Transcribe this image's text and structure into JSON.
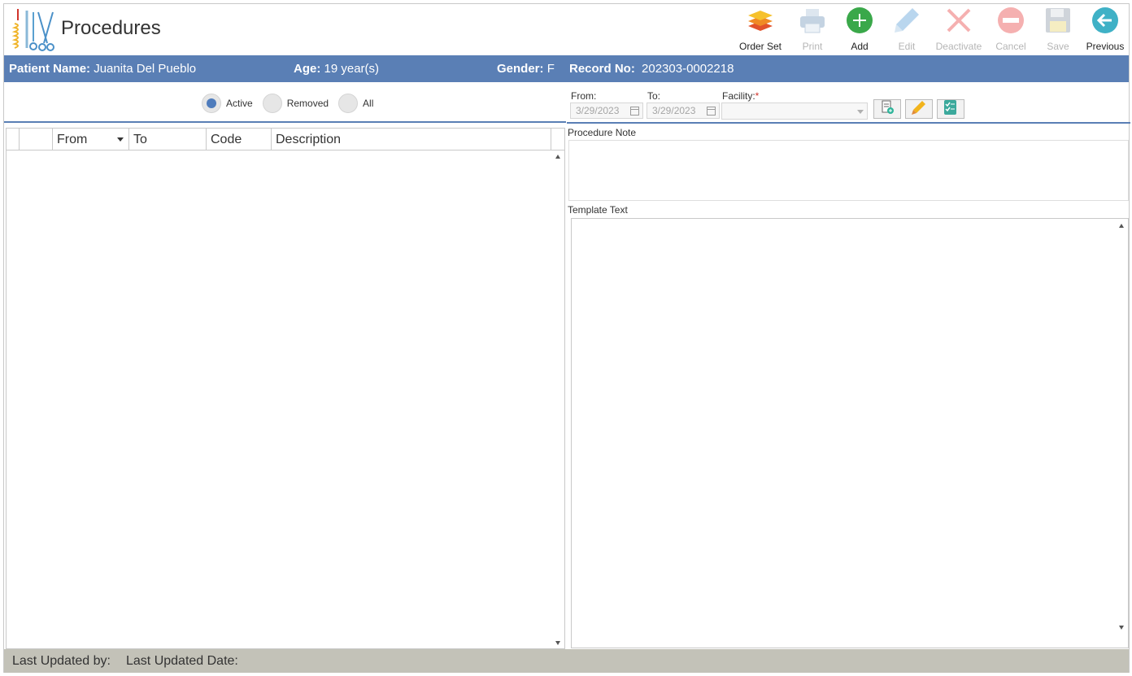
{
  "header": {
    "title": "Procedures",
    "logo_icon": "surgical-instruments-icon"
  },
  "toolbar": [
    {
      "key": "order-set",
      "label": "Order Set",
      "icon": "layers-icon",
      "enabled": true
    },
    {
      "key": "print",
      "label": "Print",
      "icon": "printer-icon",
      "enabled": false
    },
    {
      "key": "add",
      "label": "Add",
      "icon": "plus-circle-icon",
      "enabled": true
    },
    {
      "key": "edit",
      "label": "Edit",
      "icon": "pencil-icon",
      "enabled": false
    },
    {
      "key": "deactivate",
      "label": "Deactivate",
      "icon": "x-icon",
      "enabled": false
    },
    {
      "key": "cancel",
      "label": "Cancel",
      "icon": "minus-circle-icon",
      "enabled": false
    },
    {
      "key": "save",
      "label": "Save",
      "icon": "floppy-disk-icon",
      "enabled": false
    },
    {
      "key": "previous",
      "label": "Previous",
      "icon": "arrow-left-circle-icon",
      "enabled": true
    }
  ],
  "patient": {
    "name_label": "Patient Name:",
    "name": "Juanita Del Pueblo",
    "age_label": "Age:",
    "age": "19 year(s)",
    "gender_label": "Gender:",
    "gender": "F",
    "record_label": "Record No:",
    "record": "202303-0002218"
  },
  "filter": {
    "options": [
      "Active",
      "Removed",
      "All"
    ],
    "selected": "Active"
  },
  "grid": {
    "columns": [
      "",
      "",
      "From",
      "To",
      "Code",
      "Description"
    ],
    "rows": []
  },
  "form": {
    "from_label": "From:",
    "from_value": "3/29/2023",
    "to_label": "To:",
    "to_value": "3/29/2023",
    "facility_label": "Facility:",
    "facility_required": "*",
    "facility_value": "",
    "procedure_note_label": "Procedure Note",
    "procedure_note_value": "",
    "template_text_label": "Template Text",
    "template_text_value": ""
  },
  "footer": {
    "last_updated_by_label": "Last Updated by:",
    "last_updated_date_label": "Last Updated Date:"
  },
  "colors": {
    "accent": "#5a7fb5",
    "footer_bg": "#c3c2b8",
    "add_green": "#3aa84a",
    "previous_teal": "#3fb1c6"
  }
}
